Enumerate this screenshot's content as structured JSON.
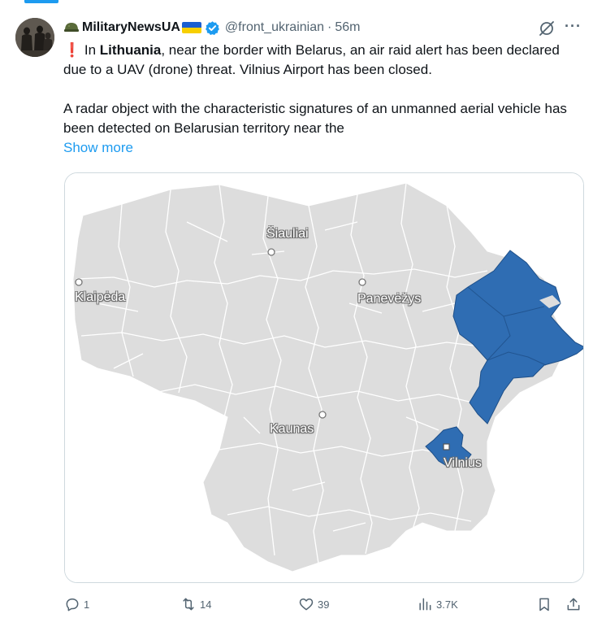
{
  "post": {
    "display_name": "MilitaryNewsUA",
    "handle": "@front_ukrainian",
    "separator": "·",
    "time": "56m",
    "text": {
      "excl": "❗",
      "p1_before": " In ",
      "p1_bold": "Lithuania",
      "p1_after": ", near the border with Belarus, an air raid alert has been declared due to a UAV (drone) threat. Vilnius Airport has been closed.",
      "p2": "A radar object with the characteristic signatures of an unmanned aerial vehicle has been detected on Belarusian territory near the",
      "show_more": "Show more"
    }
  },
  "map": {
    "cities": [
      "Šiauliai",
      "Klaipėda",
      "Panevėžys",
      "Kaunas",
      "Vilnius"
    ],
    "colors": {
      "land": "#dddddd",
      "border": "#ffffff",
      "alert": "#2f6db3",
      "alert_border": "#1e4f88"
    }
  },
  "actions": {
    "replies": "1",
    "reposts": "14",
    "likes": "39",
    "views": "3.7K"
  },
  "icons": [
    "grok-icon",
    "more-icon",
    "verified-icon",
    "reply-icon",
    "repost-icon",
    "like-icon",
    "views-icon",
    "bookmark-icon",
    "share-icon"
  ]
}
